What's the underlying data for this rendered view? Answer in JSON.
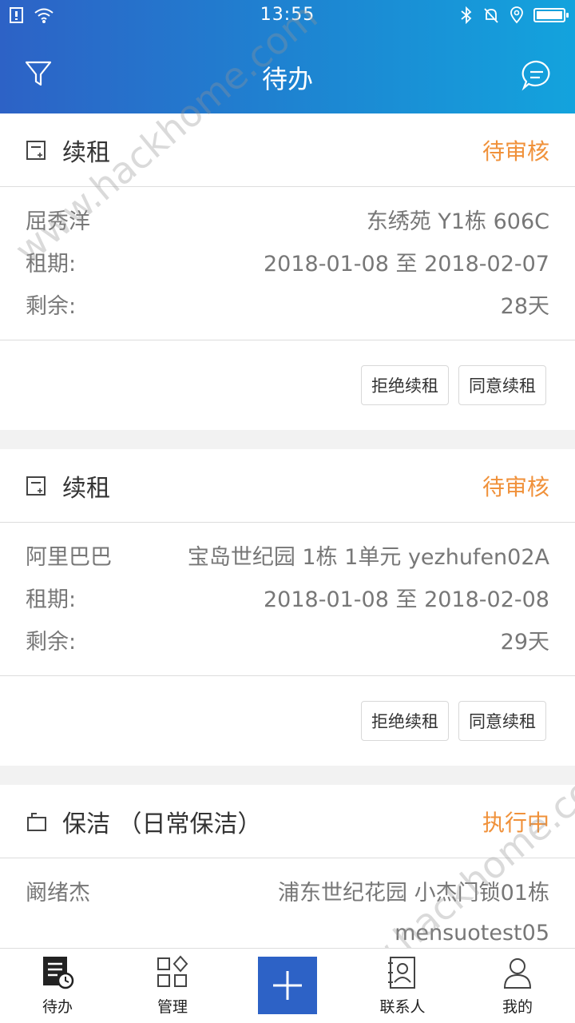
{
  "status_bar": {
    "time": "13:55"
  },
  "header": {
    "title": "待办"
  },
  "cards": [
    {
      "title": "续租",
      "status": "待审核",
      "name": "屈秀洋",
      "address": "东绣苑  Y1栋  606C",
      "period_label": "租期:",
      "period": "2018-01-08  至  2018-02-07",
      "remaining_label": "剩余:",
      "remaining": "28天",
      "reject_label": "拒绝续租",
      "agree_label": "同意续租"
    },
    {
      "title": "续租",
      "status": "待审核",
      "name": "阿里巴巴",
      "address": "宝岛世纪园  1栋  1单元  yezhufen02A",
      "period_label": "租期:",
      "period": "2018-01-08  至  2018-02-08",
      "remaining_label": "剩余:",
      "remaining": "29天",
      "reject_label": "拒绝续租",
      "agree_label": "同意续租"
    },
    {
      "title": "保洁  （日常保洁）",
      "status": "执行中",
      "name": "阚绪杰",
      "address": "浦东世纪花园  小杰门锁01栋",
      "address2": "mensuotest05"
    }
  ],
  "tabs": [
    {
      "label": "待办",
      "icon": "todo-icon"
    },
    {
      "label": "管理",
      "icon": "grid-icon"
    },
    {
      "label": "",
      "icon": "plus-icon"
    },
    {
      "label": "联系人",
      "icon": "contacts-icon"
    },
    {
      "label": "我的",
      "icon": "person-icon"
    }
  ],
  "watermark": "www.hackhome.com",
  "colors": {
    "header_start": "#2d62c6",
    "header_end": "#13a3dd",
    "status_orange": "#f0913a",
    "accent": "#2d62c6"
  }
}
